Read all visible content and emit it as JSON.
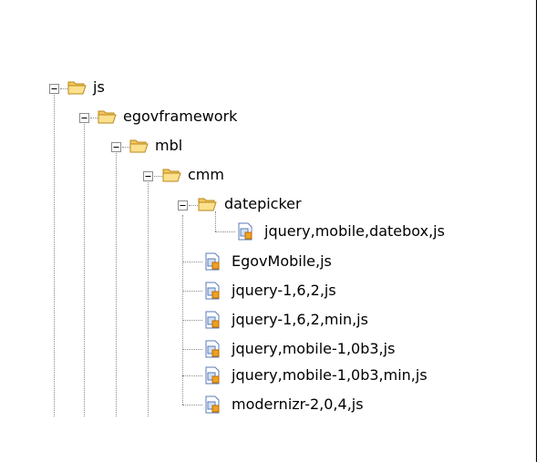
{
  "tree": {
    "nodes": [
      {
        "label": "js",
        "type": "folder",
        "expanded": true,
        "icon": "open-folder-icon"
      },
      {
        "label": "egovframework",
        "type": "folder",
        "expanded": true,
        "icon": "open-folder-icon"
      },
      {
        "label": "mbl",
        "type": "folder",
        "expanded": true,
        "icon": "open-folder-icon"
      },
      {
        "label": "cmm",
        "type": "folder",
        "expanded": true,
        "icon": "open-folder-icon"
      },
      {
        "label": "datepicker",
        "type": "folder",
        "expanded": true,
        "icon": "open-folder-icon"
      },
      {
        "label": "jquery,mobile,datebox,js",
        "type": "file",
        "icon": "js-file-icon"
      },
      {
        "label": "EgovMobile,js",
        "type": "file",
        "icon": "js-file-icon"
      },
      {
        "label": "jquery-1,6,2,js",
        "type": "file",
        "icon": "js-file-icon"
      },
      {
        "label": "jquery-1,6,2,min,js",
        "type": "file",
        "icon": "js-file-icon"
      },
      {
        "label": "jquery,mobile-1,0b3,js",
        "type": "file",
        "icon": "js-file-icon"
      },
      {
        "label": "jquery,mobile-1,0b3,min,js",
        "type": "file",
        "icon": "js-file-icon"
      },
      {
        "label": "modernizr-2,0,4,js",
        "type": "file",
        "icon": "js-file-icon"
      }
    ]
  },
  "colors": {
    "folder_fill": "#f7d26b",
    "folder_stroke": "#b8871c",
    "file_fill": "#ffffff",
    "file_stroke": "#5a7bb5",
    "file_accent": "#f0a020"
  }
}
